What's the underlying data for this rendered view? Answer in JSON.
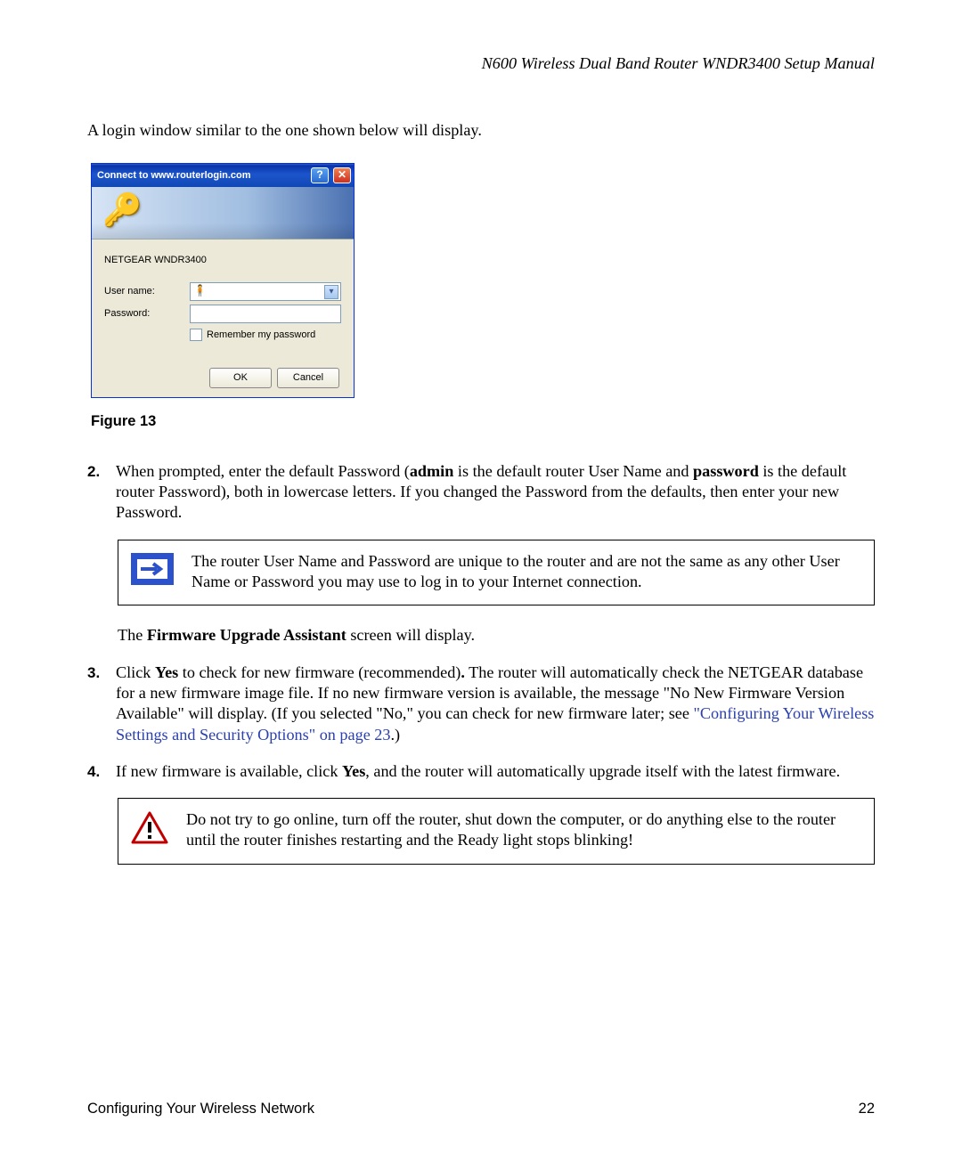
{
  "header": "N600 Wireless Dual Band Router WNDR3400 Setup Manual",
  "intro": "A login window similar to the one shown below will display.",
  "loginBox": {
    "title": "Connect to www.routerlogin.com",
    "helpGlyph": "?",
    "closeGlyph": "✕",
    "keyGlyph": "🔑",
    "device": "NETGEAR WNDR3400",
    "userLabel": "User name:",
    "userIcon": "🧍",
    "passLabel": "Password:",
    "remember": "Remember my password",
    "ok": "OK",
    "cancel": "Cancel"
  },
  "figureCaption": "Figure 13",
  "step2": {
    "num": "2.",
    "p1a": "When prompted, enter the default Password (",
    "p1b": "admin",
    "p1c": " is the default router User Name and ",
    "p1d": "password",
    "p1e": " is the default router Password), both in lowercase letters. If you changed the Password from the defaults, then enter your new Password."
  },
  "noteBox": "The router User Name and Password are unique to the router and are not the same as any other User Name or Password you may use to log in to your Internet connection.",
  "afterNote_a": "The ",
  "afterNote_b": "Firmware Upgrade Assistant",
  "afterNote_c": " screen will display.",
  "step3": {
    "num": "3.",
    "p1a": "Click ",
    "p1b": "Yes",
    "p1c": " to check for new firmware (recommended)",
    "p1d": ".",
    "p1e": " The router will automatically check the NETGEAR database for a new firmware image file. If no new firmware version is available, the message \"No New Firmware Version Available\" will display. (If you selected \"No,\" you can check for new firmware later; see ",
    "link": "\"Configuring Your Wireless Settings and Security Options\" on page 23",
    "p1f": ".)"
  },
  "step4": {
    "num": "4.",
    "p1a": "If new firmware is available, click ",
    "p1b": "Yes",
    "p1c": ", and the router will automatically upgrade itself with the latest firmware."
  },
  "warnBox": "Do not try to go online, turn off the router, shut down the computer, or do anything else to the router until the router finishes restarting and the Ready light stops blinking!",
  "footer": {
    "section": "Configuring Your Wireless Network",
    "page": "22"
  }
}
